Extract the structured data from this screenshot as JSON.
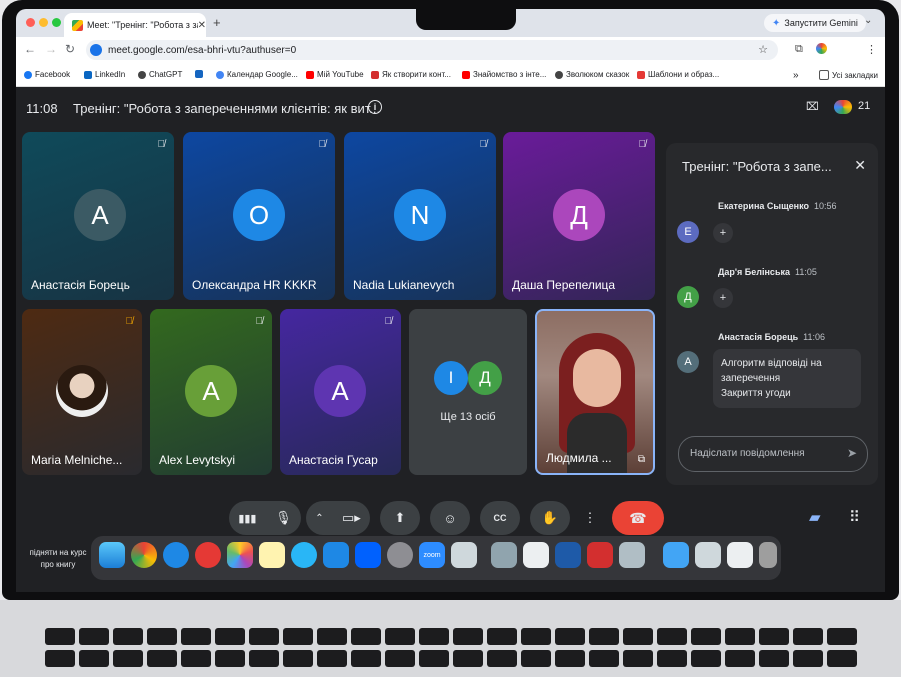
{
  "browser": {
    "tab_title": "Meet: \"Тренінг: \"Робота з зап",
    "tab_close": "✕",
    "new_tab": "+",
    "gemini_label": "Запустити Gemini",
    "url": "meet.google.com/esa-bhri-vtu?authuser=0",
    "bookmarks": [
      {
        "label": "Facebook",
        "icon_color": "#1877f2"
      },
      {
        "label": "LinkedIn",
        "icon_color": "#0a66c2"
      },
      {
        "label": "ChatGPT",
        "icon_color": "#444444"
      },
      {
        "label": "",
        "icon_color": "#1565c0"
      },
      {
        "label": "Календар Google...",
        "icon_color": "#4285f4"
      },
      {
        "label": "Мій YouTube",
        "icon_color": "#ff0000"
      },
      {
        "label": "Як створити конт...",
        "icon_color": "#d32f2f"
      },
      {
        "label": "Знайомство з інте...",
        "icon_color": "#ff0000"
      },
      {
        "label": "Зволюком сказок",
        "icon_color": "#444444"
      },
      {
        "label": "Шаблони и образ...",
        "icon_color": "#e53935"
      }
    ],
    "bookmarks_more": "»",
    "all_bookmarks": "Усі закладки"
  },
  "meeting": {
    "time": "11:08",
    "title": "Тренінг: \"Робота з запереченнями клієнтів: як вит...",
    "participants_count": "21"
  },
  "tiles": [
    {
      "name": "Анастасія Борець",
      "initial": "A",
      "bg": "#0f4a5a",
      "avatar_color": "#3b5a64"
    },
    {
      "name": "Олександра HR KKKR",
      "initial": "O",
      "bg": "#0d47a1",
      "avatar_color": "#1e88e5"
    },
    {
      "name": "Nadia Lukianevych",
      "initial": "N",
      "bg": "#0d47a1",
      "avatar_color": "#1e88e5"
    },
    {
      "name": "Даша Перепелица",
      "initial": "Д",
      "bg": "#6a1b9a",
      "avatar_color": "#ab47bc"
    },
    {
      "name": "Maria Melniche...",
      "initial": "",
      "bg": "#4e2a12",
      "avatar_color": "#f0e6dc"
    },
    {
      "name": "Alex Levytskyi",
      "initial": "A",
      "bg": "#33691e",
      "avatar_color": "#689f38"
    },
    {
      "name": "Анастасія Гусар",
      "initial": "A",
      "bg": "#4527a0",
      "avatar_color": "#5e35b1"
    },
    {
      "name": "Людмила ...",
      "initial": "",
      "bg": "#6d4c41",
      "avatar_color": ""
    }
  ],
  "more_tile": {
    "label": "Ще 13 осіб",
    "initials": [
      "I",
      "Д"
    ],
    "colors": [
      "#1e88e5",
      "#43a047"
    ]
  },
  "chat": {
    "title": "Тренінг: \"Робота з запе...",
    "messages": [
      {
        "sender": "Екатерина Сыщенко",
        "time": "10:56",
        "initial": "Е",
        "color": "#5c6bc0",
        "reaction": "+"
      },
      {
        "sender": "Дар'я Белінська",
        "time": "11:05",
        "initial": "Д",
        "color": "#43a047",
        "reaction": "+"
      },
      {
        "sender": "Анастасія Борець",
        "time": "11:06",
        "initial": "A",
        "color": "#546e7a",
        "text_lines": [
          "Алгоритм відповіді на",
          "заперечення",
          "Закриття угоди"
        ]
      }
    ],
    "input_placeholder": "Надіслати повідомлення"
  },
  "bottom_left_text": [
    "підняти на курс",
    "про книгу"
  ]
}
